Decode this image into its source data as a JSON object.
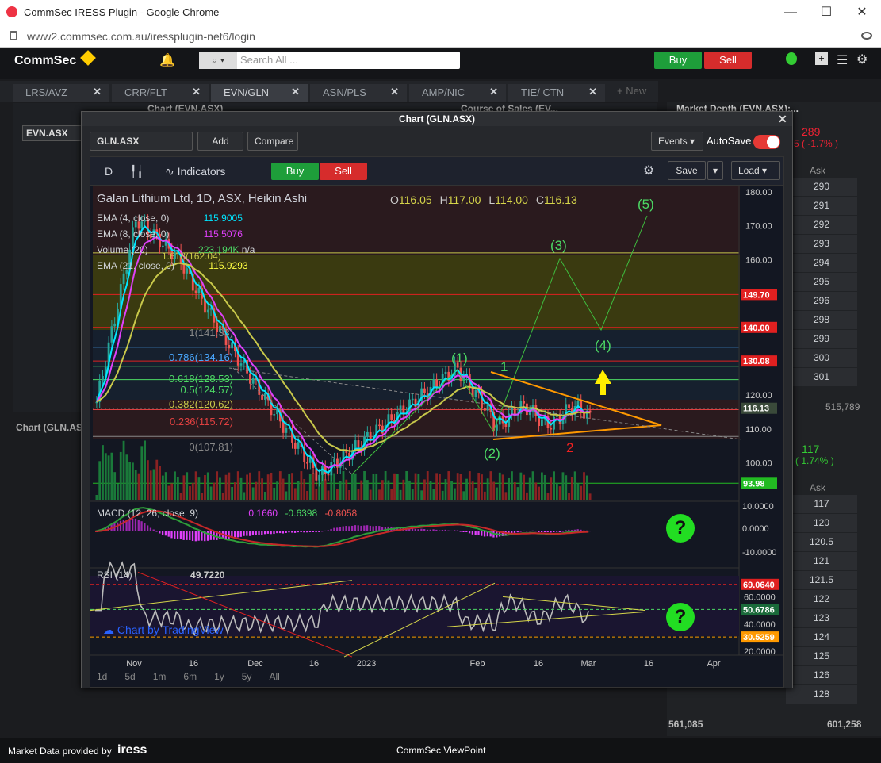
{
  "browser": {
    "title": "CommSec IRESS Plugin - Google Chrome",
    "url": "www2.commsec.com.au/iressplugin-net6/login",
    "minimize": "—",
    "maximize": "☐",
    "close": "✕"
  },
  "app": {
    "logo": "CommSec",
    "search_placeholder": "Search All ...",
    "buy": "Buy",
    "sell": "Sell"
  },
  "tabs": [
    {
      "label": "LRS/AVZ"
    },
    {
      "label": "CRR/FLT"
    },
    {
      "label": "EVN/GLN"
    },
    {
      "label": "ASN/PLS"
    },
    {
      "label": "AMP/NIC"
    },
    {
      "label": "TIE/ CTN"
    }
  ],
  "new_tab": "+ New",
  "panels": {
    "chart_evn": "Chart (EVN.ASX)",
    "course_of_sales": "Course of Sales (EV...",
    "market_depth": "Market Depth (EVN.ASX):...",
    "evn_code": "EVN.ASX",
    "chart_gln_bg": "Chart (GLN.ASX"
  },
  "depth": {
    "price": "289",
    "change": "5 ( -1.7% )",
    "ask_header": "Ask",
    "asks": [
      "290",
      "291",
      "292",
      "293",
      "294",
      "295",
      "296",
      "298",
      "299",
      "300",
      "301"
    ],
    "total_left": "",
    "total_right": "515,789",
    "price2": "117",
    "change2": "( 1.74% )",
    "ask_header2": "Ask",
    "asks2": [
      "117",
      "120",
      "120.5",
      "121",
      "121.5",
      "122",
      "123",
      "124",
      "125",
      "126",
      "128"
    ],
    "bottom_left": "561,085",
    "bottom_right": "601,258"
  },
  "dialog": {
    "title": "Chart (GLN.ASX)",
    "symbol": "GLN.ASX",
    "add": "Add",
    "compare": "Compare",
    "events": "Events",
    "autosave": "AutoSave"
  },
  "tv": {
    "interval": "D",
    "indicators": "Indicators",
    "buy": "Buy",
    "sell": "Sell",
    "save": "Save",
    "load": "Load",
    "legend_title": "Galan Lithium Ltd, 1D, ASX, Heikin Ashi",
    "ohlc": {
      "o": "O",
      "ov": "116.05",
      "h": "H",
      "hv": "117.00",
      "l": "L",
      "lv": "114.00",
      "c": "C",
      "cv": "116.13"
    },
    "ema4": "EMA (4, close, 0)",
    "ema4_val": "115.9005",
    "ema8": "EMA (8, close, 0)",
    "ema8_val": "115.5076",
    "volume": "Volume (20)",
    "volume_val": "223.194K",
    "volume_na": "n/a",
    "ema21": "EMA (21, close, 0)",
    "ema21_val": "115.9293",
    "fib_1618": "1.618(162.04)",
    "macd": "MACD (12, 26, close, 9)",
    "macd_v1": "0.1660",
    "macd_v2": "-0.6398",
    "macd_v3": "-0.8058",
    "rsi": "RSI (14)",
    "rsi_val": "49.7220",
    "watermark": "Chart by TradingView",
    "ranges": [
      "1d",
      "5d",
      "1m",
      "6m",
      "1y",
      "5y",
      "All"
    ],
    "xlabels": [
      "Nov",
      "16",
      "Dec",
      "16",
      "2023",
      "Feb",
      "16",
      "Mar",
      "16",
      "Apr"
    ],
    "price_axis": [
      "180.00",
      "170.00",
      "160.00",
      "150.00",
      "140.00",
      "130.00",
      "120.00",
      "110.00",
      "100.00"
    ],
    "price_tags": [
      {
        "v": "149.70",
        "c": "#e02020"
      },
      {
        "v": "140.00",
        "c": "#e02020"
      },
      {
        "v": "130.08",
        "c": "#e02020"
      },
      {
        "v": "116.13",
        "c": "#3a4a3a"
      },
      {
        "v": "93.98",
        "c": "#22bb22"
      }
    ],
    "macd_axis": [
      "10.0000",
      "0.0000",
      "-10.0000"
    ],
    "rsi_axis": [
      "60.0000",
      "40.0000",
      "20.0000"
    ],
    "rsi_tags": [
      {
        "v": "69.0640",
        "c": "#e02020"
      },
      {
        "v": "50.6786",
        "c": "#1a6a3a"
      },
      {
        "v": "30.5259",
        "c": "#ff9900"
      }
    ],
    "fib": [
      {
        "t": "1(141.33)",
        "c": "#888888"
      },
      {
        "t": "0.786(134.16)",
        "c": "#4aa8ff"
      },
      {
        "t": "0.618(128.53)",
        "c": "#4cd964"
      },
      {
        "t": "0.5(124.57)",
        "c": "#4cd964"
      },
      {
        "t": "0.382(120.62)",
        "c": "#c8c84a"
      },
      {
        "t": "0.236(115.72)",
        "c": "#e04040"
      },
      {
        "t": "0(107.81)",
        "c": "#888888"
      }
    ],
    "waves": [
      "(1)",
      "(2)",
      "(3)",
      "(4)",
      "(5)"
    ],
    "abc": [
      "1",
      "2"
    ],
    "question": "?"
  },
  "footer": {
    "left": "Market Data provided by",
    "brand": "iress",
    "center": "CommSec ViewPoint"
  },
  "colors": {
    "buy": "#1e9e3a",
    "sell": "#d62c2c",
    "up": "#26a69a",
    "down": "#ef5350",
    "ema4": "#00e5ff",
    "ema8": "#e040fb",
    "ema21": "#c8c84a"
  }
}
